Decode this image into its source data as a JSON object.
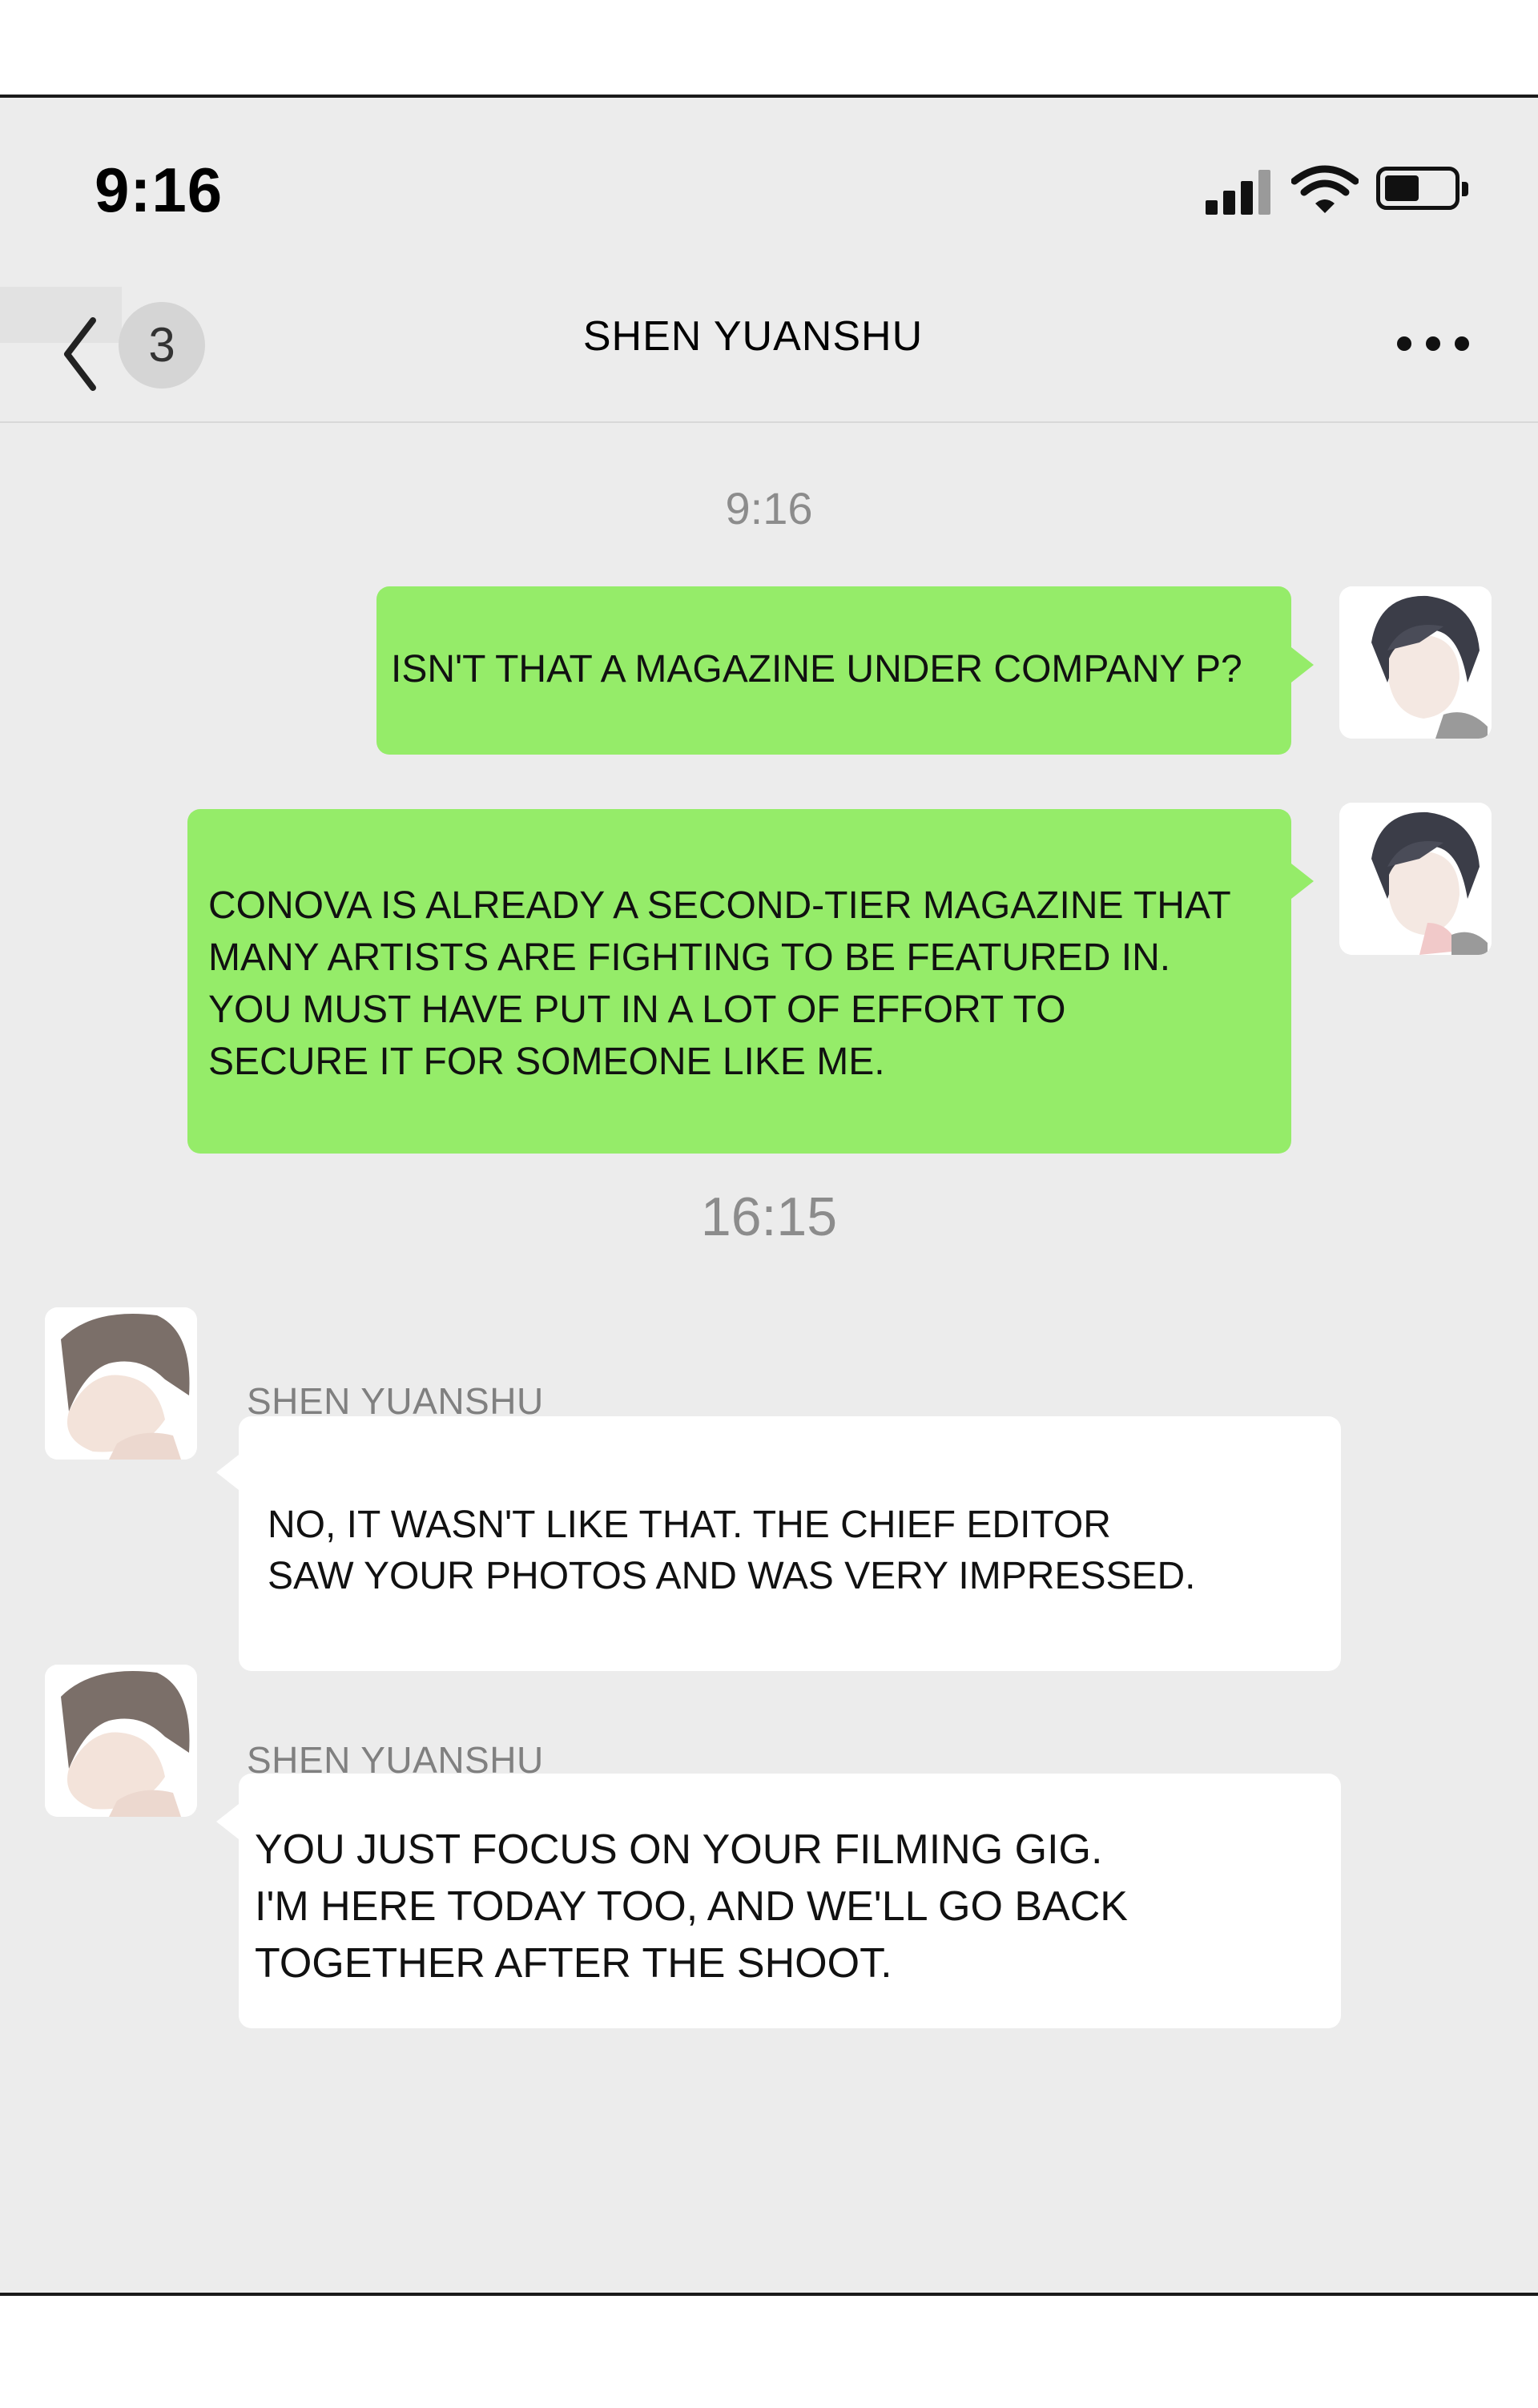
{
  "status_bar": {
    "time": "9:16",
    "icons": [
      "cellular-signal-icon",
      "wifi-icon",
      "battery-icon"
    ]
  },
  "nav": {
    "back_icon": "chevron-left-icon",
    "unread_count": "3",
    "title": "SHEN YUANSHU",
    "more_icon": "more-dots-icon"
  },
  "colors": {
    "chat_background": "#ececec",
    "outgoing_bubble": "#95ec69",
    "incoming_bubble": "#ffffff",
    "timestamp_text": "#8c8c8c"
  },
  "chat": {
    "timestamps": [
      "9:16",
      "16:15"
    ],
    "messages": [
      {
        "side": "outgoing",
        "text": "ISN'T THAT A MAGAZINE UNDER COMPANY P?"
      },
      {
        "side": "outgoing",
        "text": "CONOVA IS ALREADY A SECOND-TIER MAGAZINE THAT\nMANY ARTISTS ARE FIGHTING TO BE FEATURED IN.\nYOU MUST HAVE PUT IN A LOT OF EFFORT TO\nSECURE IT FOR SOMEONE LIKE ME."
      },
      {
        "side": "incoming",
        "sender": "SHEN YUANSHU",
        "text": "NO, IT WASN'T LIKE THAT. THE CHIEF EDITOR\nSAW YOUR PHOTOS AND WAS VERY IMPRESSED."
      },
      {
        "side": "incoming",
        "sender": "SHEN YUANSHU",
        "text": "YOU JUST FOCUS ON YOUR FILMING GIG.\nI'M HERE TODAY TOO, AND WE'LL GO BACK\nTOGETHER AFTER THE SHOOT."
      }
    ]
  }
}
